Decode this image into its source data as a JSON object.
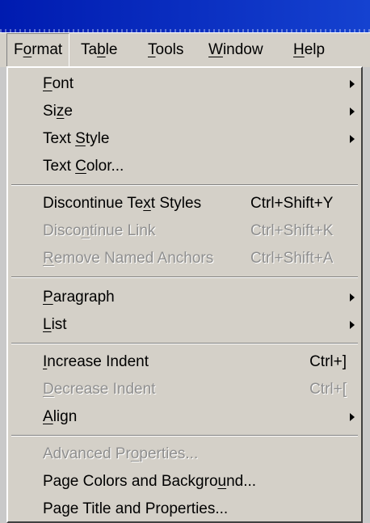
{
  "menubar": {
    "items": [
      {
        "pre": "F",
        "key": "o",
        "post": "rmat"
      },
      {
        "pre": "Ta",
        "key": "b",
        "post": "le"
      },
      {
        "pre": "",
        "key": "T",
        "post": "ools"
      },
      {
        "pre": "",
        "key": "W",
        "post": "indow"
      },
      {
        "pre": "",
        "key": "H",
        "post": "elp"
      }
    ]
  },
  "menu": {
    "font": {
      "pre": "",
      "key": "F",
      "post": "ont"
    },
    "size": {
      "pre": "Si",
      "key": "z",
      "post": "e"
    },
    "text_style": {
      "pre": "Text ",
      "key": "S",
      "post": "tyle"
    },
    "text_color": {
      "pre": "Text ",
      "key": "C",
      "post": "olor..."
    },
    "discontinue_text_styles": {
      "pre": "Discontinue Te",
      "key": "x",
      "post": "t Styles",
      "shortcut": "Ctrl+Shift+Y"
    },
    "discontinue_link": {
      "pre": "Disco",
      "key": "n",
      "post": "tinue Link",
      "shortcut": "Ctrl+Shift+K"
    },
    "remove_named_anchors": {
      "pre": "",
      "key": "R",
      "post": "emove Named Anchors",
      "shortcut": "Ctrl+Shift+A"
    },
    "paragraph": {
      "pre": "",
      "key": "P",
      "post": "aragraph"
    },
    "list": {
      "pre": "",
      "key": "L",
      "post": "ist"
    },
    "increase_indent": {
      "pre": "",
      "key": "I",
      "post": "ncrease Indent",
      "shortcut": "Ctrl+]"
    },
    "decrease_indent": {
      "pre": "",
      "key": "D",
      "post": "ecrease Indent",
      "shortcut": "Ctrl+["
    },
    "align": {
      "pre": "",
      "key": "A",
      "post": "lign"
    },
    "advanced_properties": {
      "pre": "Advanced Pr",
      "key": "o",
      "post": "perties..."
    },
    "page_colors": {
      "pre": "Page Colors and Backgro",
      "key": "u",
      "post": "nd..."
    },
    "page_title": {
      "pre": "Page Title and Properties...",
      "key": "",
      "post": ""
    }
  }
}
